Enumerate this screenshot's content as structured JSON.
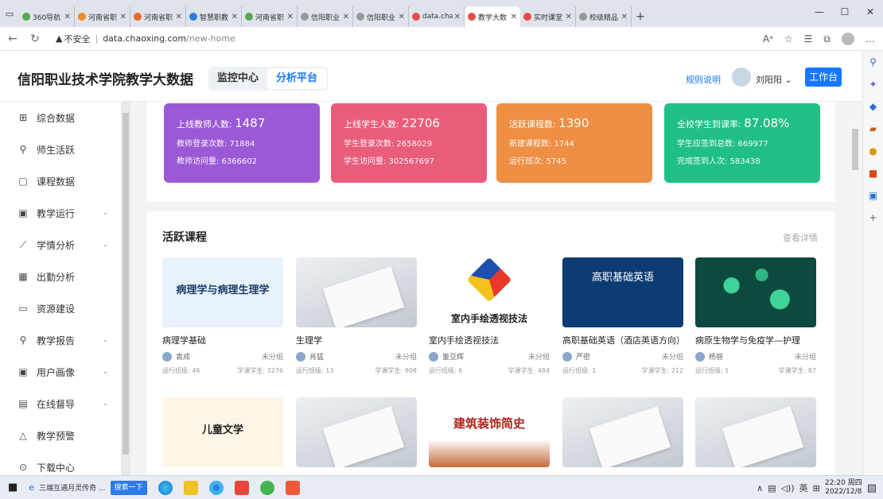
{
  "browser": {
    "tabs": [
      {
        "label": "360导航",
        "color": "#5aa454"
      },
      {
        "label": "河南省职",
        "color": "#f18a24"
      },
      {
        "label": "河南省职",
        "color": "#e86a2a"
      },
      {
        "label": "智慧职教",
        "color": "#2f7de1"
      },
      {
        "label": "河南省职",
        "color": "#5aa454"
      },
      {
        "label": "信阳职业",
        "color": "#999999"
      },
      {
        "label": "信阳职业",
        "color": "#999999"
      },
      {
        "label": "data.chao",
        "color": "#e84a4a"
      },
      {
        "label": "教学大数",
        "color": "#e84a4a",
        "active": true
      },
      {
        "label": "实时课堂",
        "color": "#e84a4a"
      },
      {
        "label": "校级精品",
        "color": "#999999"
      }
    ],
    "not_secure": "不安全",
    "url_host": "data.chaoxing.com",
    "url_path": "/new-home",
    "window_minimize": "—",
    "window_maximize": "☐",
    "window_close": "✕"
  },
  "header": {
    "title": "信阳职业技术学院教学大数据",
    "seg_monitor": "监控中心",
    "seg_analysis": "分析平台",
    "rules": "规则说明",
    "user": "刘阳阳 ⌄",
    "workbench": "工作台"
  },
  "menu": [
    {
      "icon": "⊞",
      "label": "综合数据",
      "arrow": ""
    },
    {
      "icon": "⚲",
      "label": "师生活跃",
      "arrow": ""
    },
    {
      "icon": "▢",
      "label": "课程数据",
      "arrow": ""
    },
    {
      "icon": "▣",
      "label": "教学运行",
      "arrow": "⌄"
    },
    {
      "icon": "⟋",
      "label": "学情分析",
      "arrow": "⌄"
    },
    {
      "icon": "▦",
      "label": "出勤分析",
      "arrow": ""
    },
    {
      "icon": "▭",
      "label": "资源建设",
      "arrow": ""
    },
    {
      "icon": "⚲",
      "label": "教学报告",
      "arrow": "⌄"
    },
    {
      "icon": "▣",
      "label": "用户画像",
      "arrow": "⌄"
    },
    {
      "icon": "▤",
      "label": "在线督导",
      "arrow": "⌄"
    },
    {
      "icon": "△",
      "label": "教学预警",
      "arrow": ""
    },
    {
      "icon": "⊙",
      "label": "下载中心",
      "arrow": ""
    }
  ],
  "stats": [
    {
      "color": "#9b59d6",
      "l1k": "上线教师人数: ",
      "l1v": "1487",
      "l2": "教师登录次数: 71884",
      "l3": "教师访问量: 6366602"
    },
    {
      "color": "#e95d7b",
      "l1k": "上线学生人数: ",
      "l1v": "22706",
      "l2": "学生登录次数: 2658029",
      "l3": "学生访问量: 302567697"
    },
    {
      "color": "#ef8e45",
      "l1k": "活跃课程数: ",
      "l1v": "1390",
      "l2": "新建课程数: 1744",
      "l3": "运行班次: 5745"
    },
    {
      "color": "#20c084",
      "l1k": "全校学生到课率: ",
      "l1v": "87.08%",
      "l2": "学生应签到总数: 669977",
      "l3": "完成签到人次: 583438"
    }
  ],
  "section": {
    "title": "活跃课程",
    "more": "查看详情"
  },
  "courses": [
    {
      "thumb_text": "病理学与病理生理学",
      "thumb_bg": "#e8f2fb",
      "thumb_fg": "#1d3c6b",
      "name": "病理学基础",
      "teacher": "袁成",
      "group": "未分组",
      "classes": "运行班级: 46",
      "students": "学课学生: 3276"
    },
    {
      "thumb_text": "",
      "thumb_bg": "#d9dde3",
      "thumb_fg": "#555555",
      "name": "生理学",
      "teacher": "肖猛",
      "group": "未分组",
      "classes": "运行班级: 13",
      "students": "学课学生: 908"
    },
    {
      "thumb_text": "室内手绘透视技法",
      "thumb_bg": "#ffffff",
      "thumb_fg": "#222222",
      "name": "室内手绘透视技法",
      "teacher": "董豆辉",
      "group": "未分组",
      "classes": "运行班级: 6",
      "students": "学课学生: 484"
    },
    {
      "thumb_text": "高职基础英语",
      "thumb_bg": "#0d3c74",
      "thumb_fg": "#ffffff",
      "name": "高职基础英语（酒店英语方向）",
      "teacher": "严密",
      "group": "未分组",
      "classes": "运行班级: 1",
      "students": "学课学生: 212"
    },
    {
      "thumb_text": "",
      "thumb_bg": "#0f6b5a",
      "thumb_fg": "#ffffff",
      "name": "病原生物学与免疫学—护理",
      "teacher": "杨丽",
      "group": "未分组",
      "classes": "运行班级: 1",
      "students": "学课学生: 87"
    },
    {
      "thumb_text": "儿童文学",
      "thumb_bg": "#fdf6e6",
      "thumb_fg": "#222222",
      "name": "",
      "teacher": "",
      "group": "",
      "classes": "",
      "students": ""
    },
    {
      "thumb_text": "",
      "thumb_bg": "#d9dde3",
      "thumb_fg": "#555555",
      "name": "",
      "teacher": "",
      "group": "",
      "classes": "",
      "students": ""
    },
    {
      "thumb_text": "建筑装饰简史",
      "thumb_bg": "#ffffff",
      "thumb_fg": "#b3221c",
      "name": "",
      "teacher": "",
      "group": "",
      "classes": "",
      "students": ""
    },
    {
      "thumb_text": "",
      "thumb_bg": "#d9dde3",
      "thumb_fg": "#555555",
      "name": "",
      "teacher": "",
      "group": "",
      "classes": "",
      "students": ""
    },
    {
      "thumb_text": "",
      "thumb_bg": "#d9dde3",
      "thumb_fg": "#555555",
      "name": "",
      "teacher": "",
      "group": "",
      "classes": "",
      "students": ""
    }
  ],
  "taskbar": {
    "ie_label": "三端互通月灵传奇 ...",
    "search": "搜索一下",
    "lang": "英",
    "time": "22:20 周四",
    "date": "2022/12/8"
  }
}
